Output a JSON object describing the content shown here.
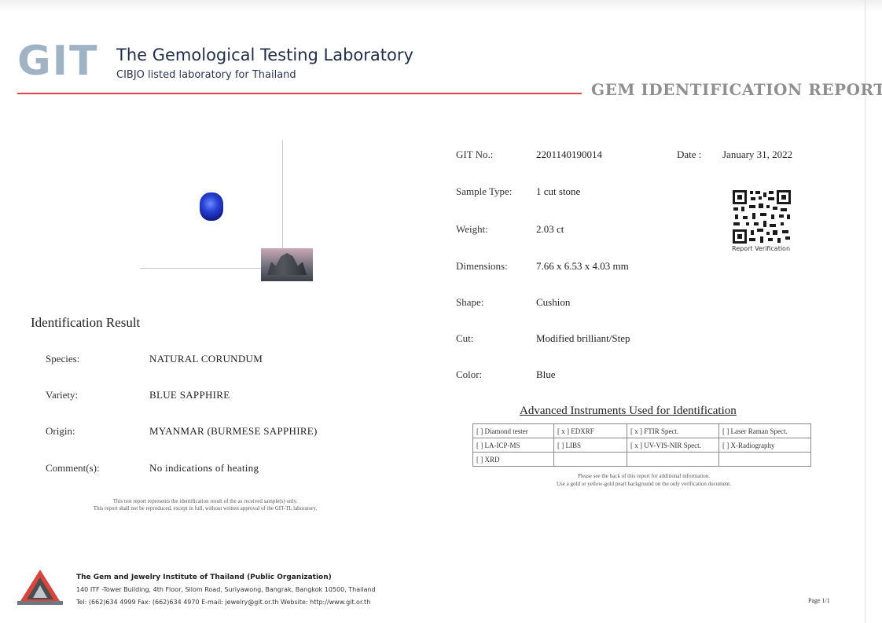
{
  "header": {
    "logo_text": "GIT",
    "lab_title": "The Gemological Testing Laboratory",
    "lab_subtitle": "CIBJO listed laboratory for Thailand",
    "report_type": "GEM IDENTIFICATION REPORT"
  },
  "details": {
    "git_no_label": "GIT No.:",
    "git_no_value": "2201140190014",
    "date_label": "Date :",
    "date_value": "January 31, 2022",
    "sample_type_label": "Sample Type:",
    "sample_type_value": "1 cut stone",
    "weight_label": "Weight:",
    "weight_value": "2.03  ct",
    "dimensions_label": "Dimensions:",
    "dimensions_value": "7.66 x 6.53 x 4.03 mm",
    "shape_label": "Shape:",
    "shape_value": "Cushion",
    "cut_label": "Cut:",
    "cut_value": "Modified brilliant/Step",
    "color_label": "Color:",
    "color_value": "Blue",
    "qr_caption": "Report Verification"
  },
  "identification": {
    "heading": "Identification Result",
    "species_label": "Species:",
    "species_value": "NATURAL  CORUNDUM",
    "variety_label": "Variety:",
    "variety_value": "BLUE  SAPPHIRE",
    "origin_label": "Origin:",
    "origin_value": "MYANMAR  (BURMESE  SAPPHIRE)",
    "comments_label": "Comment(s):",
    "comments_value": "No indications of heating"
  },
  "disclaimer": {
    "line1": "This test report represents the identification result of the as received sample(s) only.",
    "line2": "This report shall not be reproduced, except in full, without written approval of the GIT-TL laboratory."
  },
  "instruments": {
    "heading": "Advanced Instruments Used for Identification",
    "rows": [
      [
        "[   ] Diamond tester",
        "[ x ] EDXRF",
        "[ x ] FTIR Spect.",
        "[   ] Laser Raman Spect."
      ],
      [
        "[   ] LA-ICP-MS",
        "[   ] LIBS",
        "[ x ] UV-VIS-NIR Spect.",
        "[   ] X-Radiography"
      ],
      [
        "[   ] XRD",
        "",
        "",
        ""
      ]
    ],
    "note1": "Please see the back of this report for additional information.",
    "note2": "Use a gold or yellow-gold pearl background on the only verification document."
  },
  "footer": {
    "org_name": "The Gem and Jewelry Institute of Thailand (Public Organization)",
    "address": "140 ITF -Tower Building, 4th Floor, Silom Road, Suriyawong, Bangrak, Bangkok 10500, Thailand",
    "contact": "Tel: (662)634 4999 Fax: (662)634 4970  E-mail: jewelry@git.or.th  Website: http://www.git.or.th",
    "page": "Page 1/1"
  },
  "colors": {
    "accent_red": "#e04545",
    "logo_grey_blue": "#9fb3c4",
    "gem_blue": "#2a44d6"
  }
}
